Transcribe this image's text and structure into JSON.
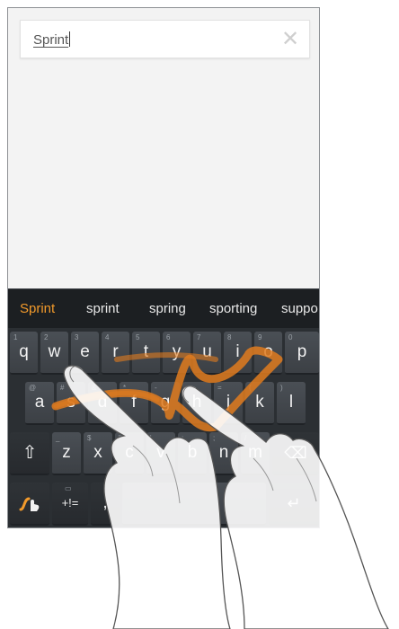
{
  "search": {
    "text": "Sprint",
    "clear_icon": "close-icon"
  },
  "suggestions": [
    "Sprint",
    "sprint",
    "spring",
    "sporting",
    "suppo"
  ],
  "keyboard": {
    "row1": [
      {
        "label": "q",
        "sub": "1"
      },
      {
        "label": "w",
        "sub": "2"
      },
      {
        "label": "e",
        "sub": "3"
      },
      {
        "label": "r",
        "sub": "4"
      },
      {
        "label": "t",
        "sub": "5"
      },
      {
        "label": "y",
        "sub": "6"
      },
      {
        "label": "u",
        "sub": "7"
      },
      {
        "label": "i",
        "sub": "8"
      },
      {
        "label": "o",
        "sub": "9"
      },
      {
        "label": "p",
        "sub": "0"
      }
    ],
    "row2": [
      {
        "label": "a",
        "sub": "@"
      },
      {
        "label": "s",
        "sub": "#"
      },
      {
        "label": "d",
        "sub": "&"
      },
      {
        "label": "f",
        "sub": "*"
      },
      {
        "label": "g",
        "sub": "-"
      },
      {
        "label": "h",
        "sub": "+"
      },
      {
        "label": "j",
        "sub": "="
      },
      {
        "label": "k",
        "sub": "("
      },
      {
        "label": "l",
        "sub": ")"
      }
    ],
    "row3": [
      {
        "label": "z",
        "sub": "_"
      },
      {
        "label": "x",
        "sub": "$"
      },
      {
        "label": "c",
        "sub": "\""
      },
      {
        "label": "v",
        "sub": "'"
      },
      {
        "label": "b",
        "sub": ":"
      },
      {
        "label": "n",
        "sub": ";"
      },
      {
        "label": "m",
        "sub": "/"
      }
    ],
    "shift_icon": "shift-icon",
    "swype_icon": "swype-icon",
    "symbols_label": "+!=",
    "comma_label": ","
  },
  "colors": {
    "accent": "#f29a2b",
    "trace": "#e07b1f"
  }
}
